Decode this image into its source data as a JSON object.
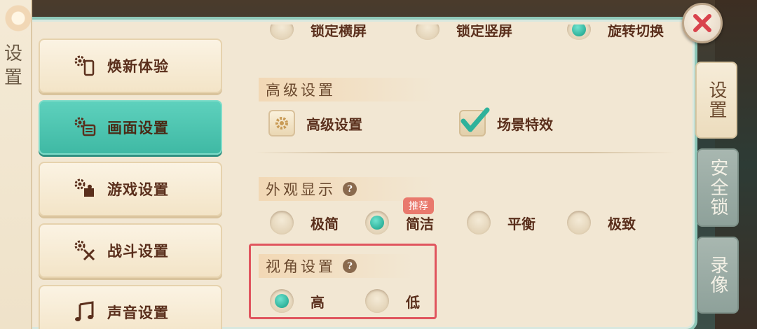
{
  "panel": {
    "title": "设置"
  },
  "sidebar": {
    "items": [
      {
        "label": "焕新体验",
        "icon": "gear-phone-icon",
        "active": false
      },
      {
        "label": "画面设置",
        "icon": "gear-screen-icon",
        "active": true
      },
      {
        "label": "游戏设置",
        "icon": "gear-puzzle-icon",
        "active": false
      },
      {
        "label": "战斗设置",
        "icon": "gear-sword-icon",
        "active": false
      },
      {
        "label": "声音设置",
        "icon": "music-note-icon",
        "active": false
      }
    ]
  },
  "orientation": {
    "options": [
      {
        "label": "锁定横屏",
        "selected": false
      },
      {
        "label": "锁定竖屏",
        "selected": false
      },
      {
        "label": "旋转切换",
        "selected": true
      }
    ]
  },
  "advanced": {
    "title": "高级设置",
    "button_label": "高级设置",
    "effects_label": "场景特效",
    "effects_checked": true
  },
  "appearance": {
    "title": "外观显示",
    "help": "?",
    "recommend_badge": "推荐",
    "options": [
      {
        "label": "极简",
        "selected": false
      },
      {
        "label": "简洁",
        "selected": true
      },
      {
        "label": "平衡",
        "selected": false
      },
      {
        "label": "极致",
        "selected": false
      }
    ]
  },
  "camera": {
    "title": "视角设置",
    "help": "?",
    "options": [
      {
        "label": "高",
        "selected": true
      },
      {
        "label": "低",
        "selected": false
      }
    ]
  },
  "right_tabs": [
    {
      "label": "设置",
      "active": true
    },
    {
      "label": "安全锁",
      "active": false
    },
    {
      "label": "录像",
      "active": false
    }
  ],
  "colors": {
    "accent": "#3fb9a4",
    "highlight_border": "#e0555e",
    "badge": "#e9796d",
    "text": "#5a2f1c"
  }
}
